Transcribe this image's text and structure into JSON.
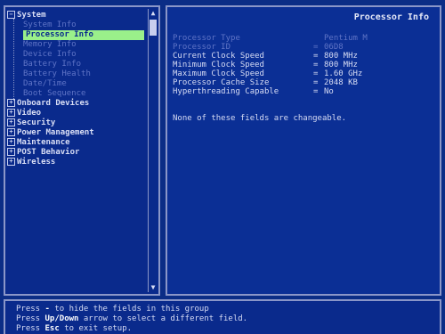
{
  "tree": {
    "items": [
      {
        "label": "System",
        "type": "parent",
        "expander": "−"
      },
      {
        "label": "System Info",
        "type": "child"
      },
      {
        "label": "Processor Info",
        "type": "child",
        "active": true
      },
      {
        "label": "Memory Info",
        "type": "child"
      },
      {
        "label": "Device Info",
        "type": "child"
      },
      {
        "label": "Battery Info",
        "type": "child"
      },
      {
        "label": "Battery Health",
        "type": "child"
      },
      {
        "label": "Date/Time",
        "type": "child"
      },
      {
        "label": "Boot Sequence",
        "type": "child"
      },
      {
        "label": "Onboard Devices",
        "type": "parent",
        "expander": "+"
      },
      {
        "label": "Video",
        "type": "parent",
        "expander": "+"
      },
      {
        "label": "Security",
        "type": "parent",
        "expander": "+"
      },
      {
        "label": "Power Management",
        "type": "parent",
        "expander": "+"
      },
      {
        "label": "Maintenance",
        "type": "parent",
        "expander": "+"
      },
      {
        "label": "POST Behavior",
        "type": "parent",
        "expander": "+"
      },
      {
        "label": "Wireless",
        "type": "parent",
        "expander": "+"
      }
    ],
    "scroll_up": "▲",
    "scroll_down": "▼"
  },
  "info": {
    "title": "Processor Info",
    "fields": [
      {
        "label": "Processor Type",
        "sep": "",
        "value": "Pentium M",
        "dim": true
      },
      {
        "label": "Processor ID",
        "sep": "=",
        "value": "06D8",
        "dim": true
      },
      {
        "label": "Current Clock Speed",
        "sep": "=",
        "value": "800 MHz",
        "dim": false
      },
      {
        "label": "Minimum Clock Speed",
        "sep": "=",
        "value": "800 MHz",
        "dim": false
      },
      {
        "label": "Maximum Clock Speed",
        "sep": "=",
        "value": "1.60 GHz",
        "dim": false
      },
      {
        "label": "Processor Cache Size",
        "sep": "=",
        "value": "2048 KB",
        "dim": false
      },
      {
        "label": "Hyperthreading Capable",
        "sep": "=",
        "value": "No",
        "dim": false
      }
    ],
    "note": "None of these fields are changeable."
  },
  "help": {
    "line1_pre": "Press",
    "line1_key": "-",
    "line1_post": "to hide the fields in this group",
    "line2_pre": "Press",
    "line2_key": "Up/Down",
    "line2_post": "arrow to select a different field.",
    "line3_pre": "Press",
    "line3_key": "Esc",
    "line3_post": "to exit setup."
  }
}
